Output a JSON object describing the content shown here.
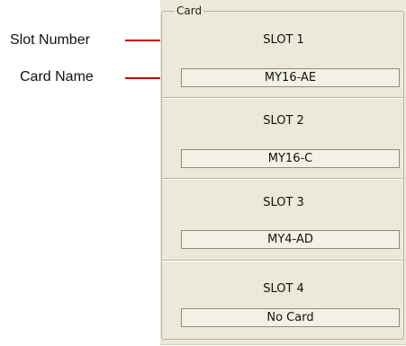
{
  "callouts": {
    "slot_number": "Slot Number",
    "card_name": "Card Name"
  },
  "panel": {
    "legend": "Card",
    "slots": [
      {
        "label": "SLOT 1",
        "card": "MY16-AE"
      },
      {
        "label": "SLOT 2",
        "card": "MY16-C"
      },
      {
        "label": "SLOT 3",
        "card": "MY4-AD"
      },
      {
        "label": "SLOT 4",
        "card": "No Card"
      }
    ]
  },
  "colors": {
    "leader_line": "#c00000",
    "panel_bg": "#ece9d8"
  }
}
